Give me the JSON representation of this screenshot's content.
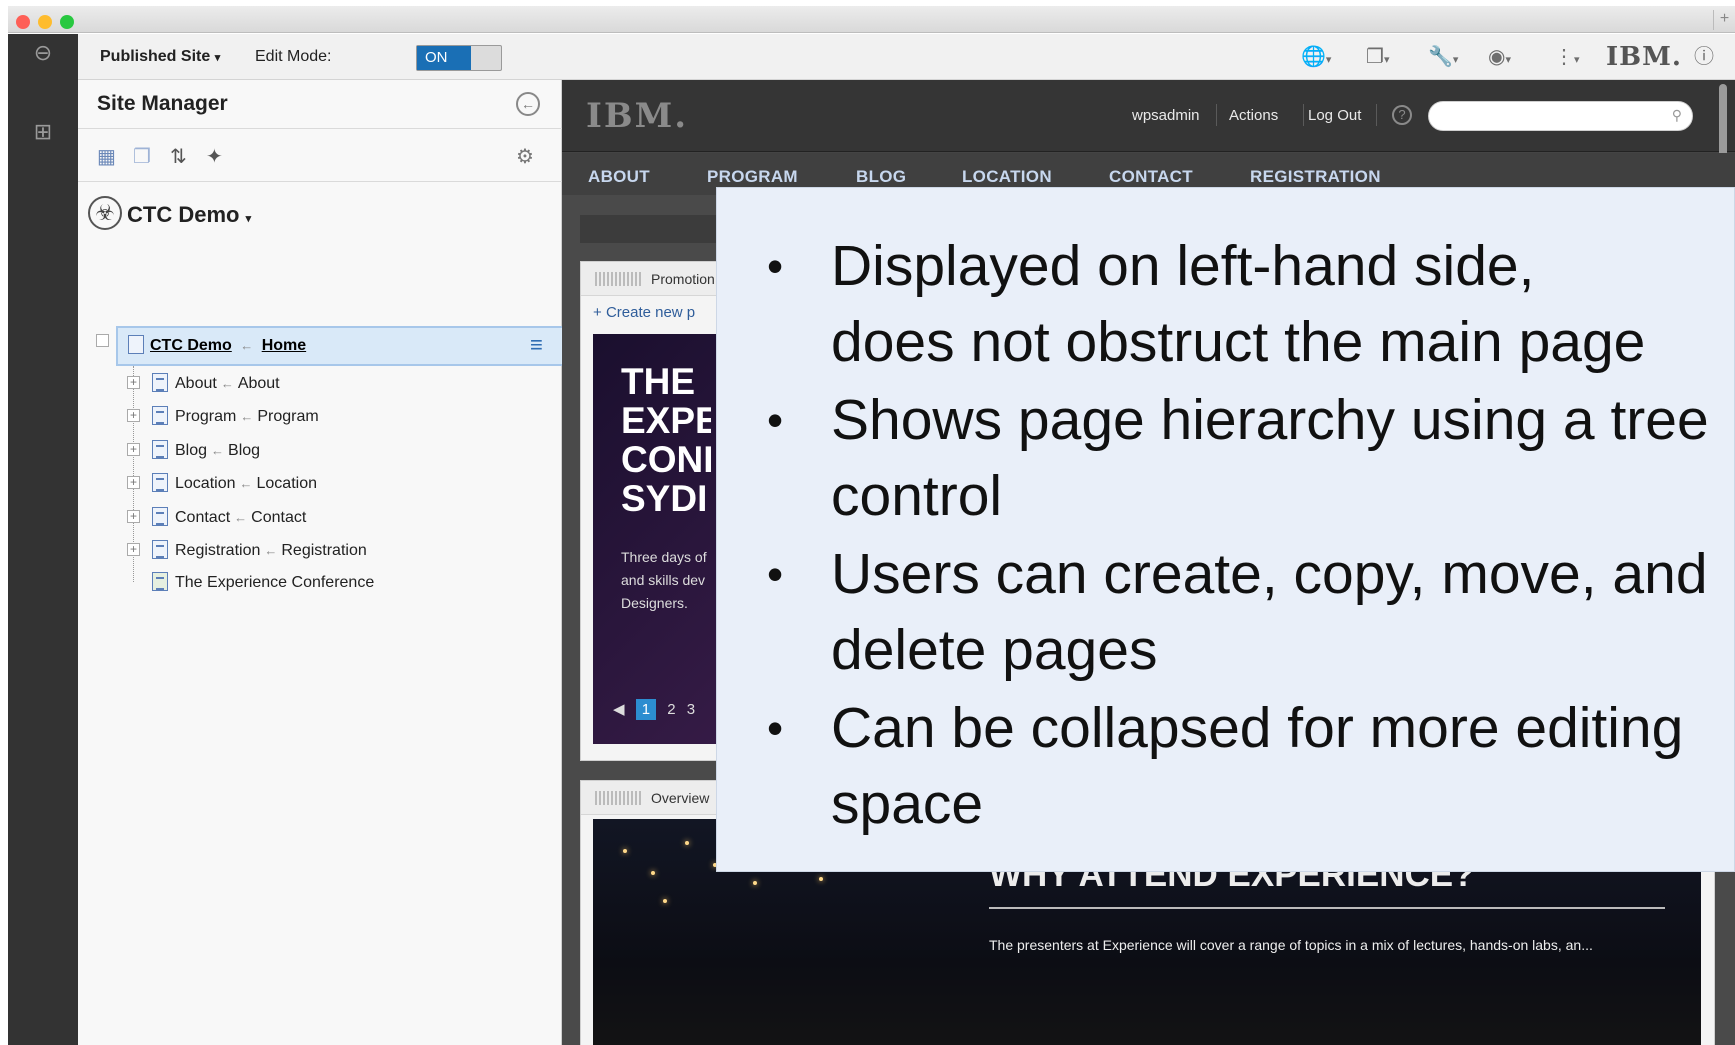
{
  "window": {
    "controls": [
      "close",
      "minimize",
      "zoom"
    ],
    "new_tab_label": "+"
  },
  "toolbar": {
    "site_selector": "Published Site",
    "edit_mode_label": "Edit Mode:",
    "edit_mode_state": "ON",
    "brand": "IBM.",
    "icons": [
      "globe-icon",
      "pages-icon",
      "wrench-icon",
      "eye-icon",
      "more-icon",
      "info-icon"
    ]
  },
  "site_manager": {
    "title": "Site Manager",
    "site_name": "CTC Demo",
    "tree": [
      {
        "title": "CTC Demo",
        "arrow": "←",
        "target": "Home"
      },
      {
        "title": "About",
        "arrow": "←",
        "target": "About"
      },
      {
        "title": "Program",
        "arrow": "←",
        "target": "Program"
      },
      {
        "title": "Blog",
        "arrow": "←",
        "target": "Blog"
      },
      {
        "title": "Location",
        "arrow": "←",
        "target": "Location"
      },
      {
        "title": "Contact",
        "arrow": "←",
        "target": "Contact"
      },
      {
        "title": "Registration",
        "arrow": "←",
        "target": "Registration"
      },
      {
        "title": "The Experience Conference",
        "arrow": "",
        "target": ""
      }
    ]
  },
  "preview": {
    "logo": "IBM.",
    "header_links": [
      "wpsadmin",
      "Actions",
      "Log Out"
    ],
    "nav": [
      "ABOUT",
      "PROGRAM",
      "BLOG",
      "LOCATION",
      "CONTACT",
      "REGISTRATION"
    ],
    "promotion": {
      "title": "Promotion",
      "create_new": "Create new p",
      "hero_title": "THE\nEXPE\nCONI\nSYDI",
      "hero_sub": "Three days of\nand skills dev\nDesigners.",
      "pager": [
        "1",
        "2",
        "3"
      ]
    },
    "overview": {
      "title": "Overview",
      "heading": "WHY ATTEND EXPERIENCE?",
      "text": "The presenters at Experience will cover a range of topics in a mix of lectures, hands-on labs, an..."
    }
  },
  "callout": {
    "bullets": [
      "Displayed on left-hand side,\ndoes not obstruct the main page",
      "Shows page hierarchy using a tree\ncontrol",
      "Users can create, copy, move, and\ndelete pages",
      "Can be collapsed for more editing\nspace"
    ]
  }
}
